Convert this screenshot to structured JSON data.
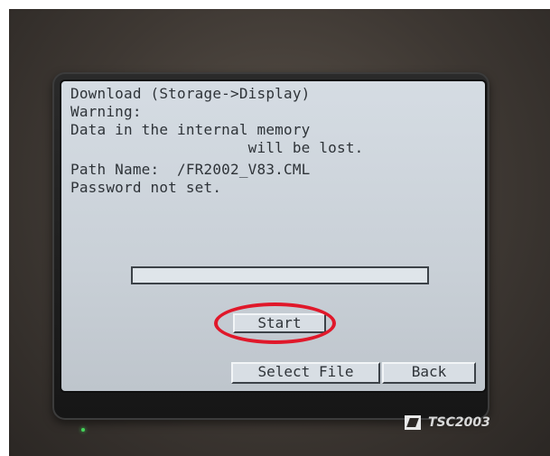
{
  "screen": {
    "lines": [
      "Download (Storage->Display)",
      "Warning:",
      "Data in the internal memory",
      "                    will be lost.",
      "Path Name:  /FR2002_V83.CML",
      "Password not set."
    ],
    "progress": 0
  },
  "buttons": {
    "start": "Start",
    "select_file": "Select File",
    "back": "Back"
  },
  "device": {
    "brand": "TSC2003"
  },
  "colors": {
    "screen_bg": "#cfd6dd",
    "highlight": "#e0182a"
  }
}
